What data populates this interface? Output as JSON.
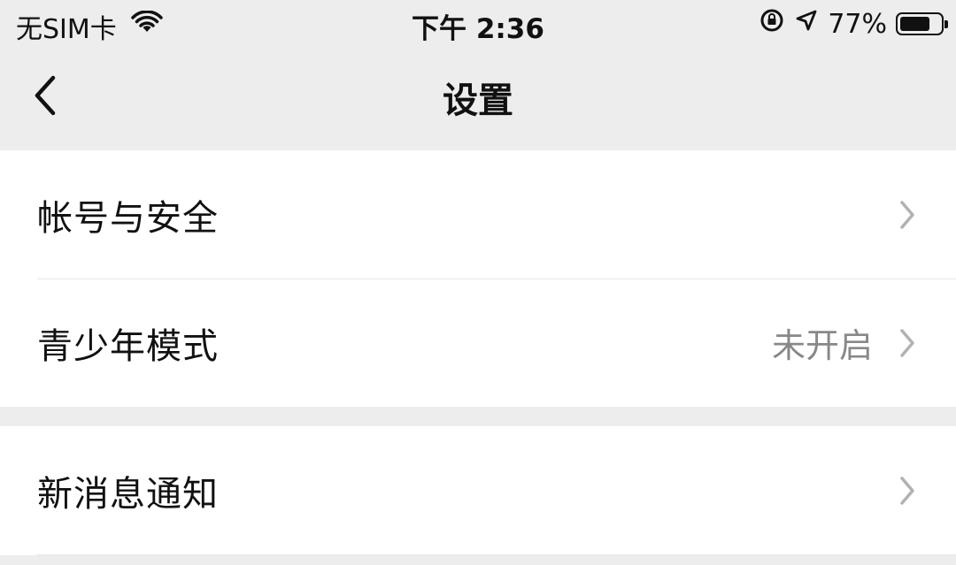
{
  "status_bar": {
    "carrier": "无SIM卡",
    "time": "下午 2:36",
    "battery_percent": "77%",
    "battery_level": 0.77,
    "icons": [
      "wifi-icon",
      "orientation-lock-icon",
      "location-arrow-icon",
      "battery-icon"
    ]
  },
  "nav": {
    "title": "设置",
    "back_icon": "chevron-left-icon"
  },
  "groups": [
    {
      "items": [
        {
          "label": "帐号与安全",
          "value": ""
        },
        {
          "label": "青少年模式",
          "value": "未开启"
        }
      ]
    },
    {
      "items": [
        {
          "label": "新消息通知",
          "value": ""
        }
      ]
    }
  ],
  "colors": {
    "background": "#ededed",
    "card": "#ffffff",
    "secondary_text": "#888888",
    "chevron": "#b2b2b2"
  }
}
